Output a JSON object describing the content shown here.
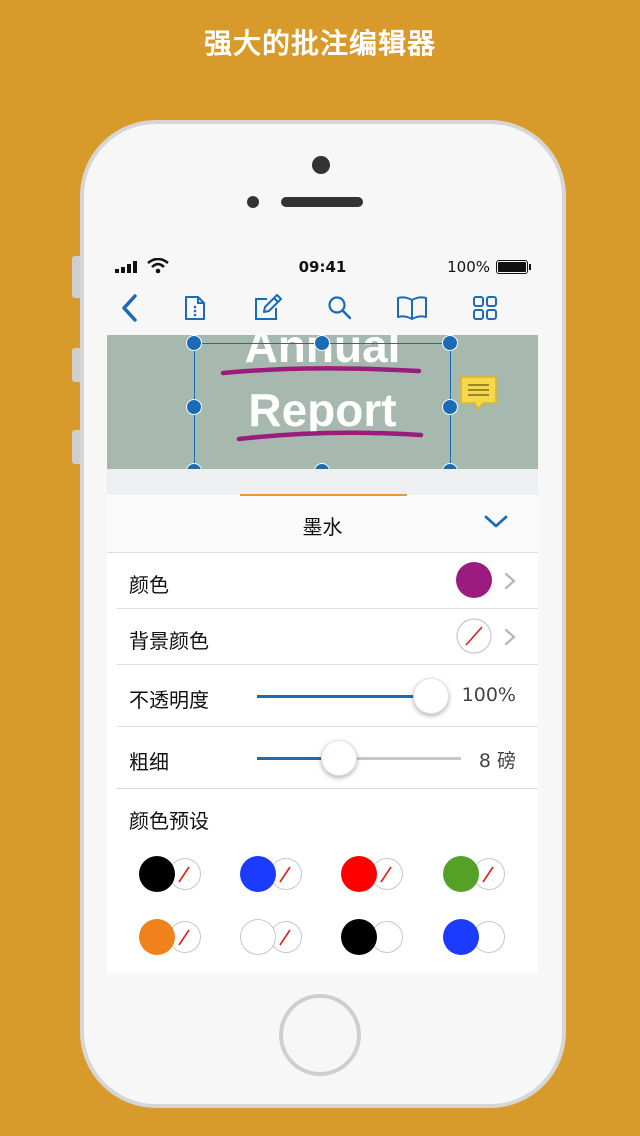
{
  "headline": "强大的批注编辑器",
  "status": {
    "time": "09:41",
    "battery": "100%"
  },
  "toolbar": {
    "icons": [
      "back-chevron-icon",
      "document-info-icon",
      "annotate-pen-icon",
      "search-icon",
      "book-icon",
      "grid-icon"
    ]
  },
  "document": {
    "line1": "Annual",
    "line2": "Report"
  },
  "panel": {
    "title": "墨水",
    "rows": {
      "color": {
        "label": "颜色",
        "value": "#9B1B7E"
      },
      "background": {
        "label": "背景颜色",
        "value": "none"
      },
      "opacity": {
        "label": "不透明度",
        "value": "100%",
        "level": 1.0
      },
      "thickness": {
        "label": "粗细",
        "value": "8 磅",
        "level": 0.4
      }
    },
    "presets_title": "颜色预设",
    "presets": [
      {
        "fg": "#000000",
        "bg": "none"
      },
      {
        "fg": "#1B3BFF",
        "bg": "none"
      },
      {
        "fg": "#FF0000",
        "bg": "none"
      },
      {
        "fg": "#55A127",
        "bg": "none"
      },
      {
        "fg": "#F0821E",
        "bg": "none"
      },
      {
        "fg": "#FFFFFF",
        "bg": "none"
      },
      {
        "fg": "#000000",
        "bg": "#FFFFFF"
      },
      {
        "fg": "#1B3BFF",
        "bg": "#FFFFFF"
      }
    ]
  },
  "colors": {
    "background": "#D89A2B",
    "accent": "#1C6CB5",
    "ink": "#9B1B7E",
    "note": "#F6D94B"
  }
}
